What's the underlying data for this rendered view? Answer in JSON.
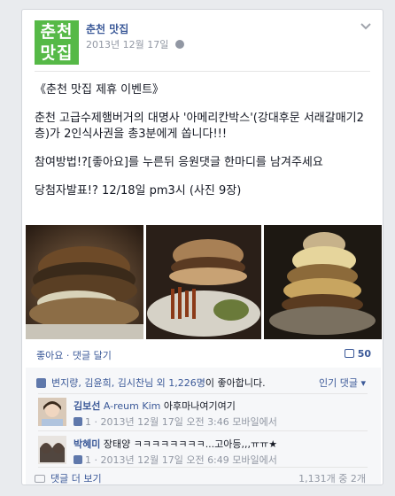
{
  "page": {
    "logo_line1": "춘천",
    "logo_line2": "맛집",
    "name": "춘천 맛집",
    "date": "2013년 12월 17일",
    "more_icon": "chevron-down-icon"
  },
  "post": {
    "line1": "《춘천 맛집 제휴 이벤트》",
    "line2": "춘천 고급수제햄버거의 대명사 '아메리칸박스'(강대후문 서래갈매기2층)가 2인식사권을 총3분에게 쏩니다!!!",
    "line3": "참여방법!?[좋아요]를 누른뒤 응원댓글 한마디를 남겨주세요",
    "line4_prefix": "당첨자발표!? 12/18일 pm3시 ",
    "line4_link": "(사진 9장)"
  },
  "actions": {
    "like_comment": "좋아요 · 댓글 달기",
    "comment_count": "50"
  },
  "likes": {
    "names": "변지량, 김윤희, 김시찬님 외 1,226명",
    "suffix": "이 좋아합니다.",
    "sort_label": "인기 댓글 ▾"
  },
  "comments": [
    {
      "name": "김보선",
      "alias": "A-reum Kim",
      "text": "아후마나여기여기",
      "likes": "1",
      "meta": " · 2013년 12월 17일 오전 3:46 모바일에서"
    },
    {
      "name": "박혜미",
      "alias": "",
      "text": "장태양 ㅋㅋㅋㅋㅋㅋㅋㅋ...고아등,,,ㅠㅠ★",
      "likes": "1",
      "meta": " · 2013년 12월 17일 오전 6:49 모바일에서"
    }
  ],
  "more": {
    "label": "댓글 더 보기",
    "count": "1,131개 중 2개"
  }
}
